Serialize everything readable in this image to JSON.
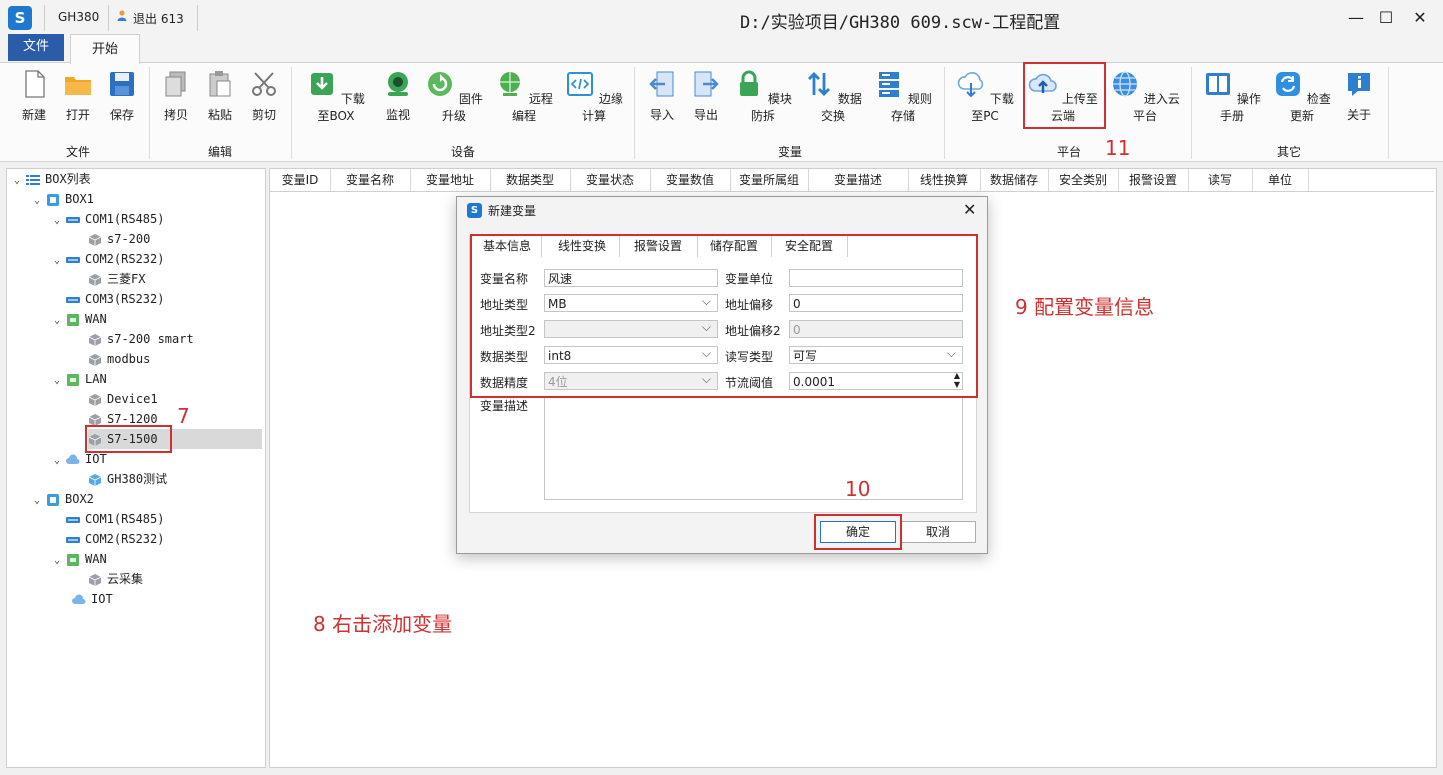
{
  "titlebar": {
    "app_logo": "S",
    "device_name": "GH380",
    "logout_label": "退出 613",
    "window_title": "D:/实验项目/GH380 609.scw-工程配置",
    "minimize": "—",
    "maximize": "☐",
    "close": "✕"
  },
  "ribbon_tabs": {
    "file": "文件",
    "start": "开始"
  },
  "ribbon": {
    "buttons": {
      "new": "新建",
      "open": "打开",
      "save": "保存",
      "copy": "拷贝",
      "paste": "粘贴",
      "cut": "剪切",
      "download_box": "下载至BOX",
      "monitor": "监视",
      "firmware": "固件升级",
      "remote_program": "远程编程",
      "edge_compute": "边缘计算",
      "import": "导入",
      "export": "导出",
      "module_protect": "模块防拆",
      "data_exchange": "数据交换",
      "rule_storage": "规则存储",
      "download_pc": "下载至PC",
      "upload_cloud": "上传至云端",
      "enter_cloud": "进入云平台",
      "manual": "操作手册",
      "check_update": "检查更新",
      "about": "关于"
    },
    "groups": {
      "file": "文件",
      "edit": "编辑",
      "device": "设备",
      "variable": "变量",
      "platform": "平台",
      "other": "其它"
    }
  },
  "tree": {
    "root": "BOX列表",
    "nodes": {
      "box1": "BOX1",
      "com1": "COM1(RS485)",
      "s7200": "s7-200",
      "com2": "COM2(RS232)",
      "mitsubishi": "三菱FX",
      "com3": "COM3(RS232)",
      "wan": "WAN",
      "s7200smart": "s7-200 smart",
      "modbus": "modbus",
      "lan": "LAN",
      "device1": "Device1",
      "s71200": "S7-1200",
      "s71500": "S7-1500",
      "iot": "IOT",
      "gh380test": "GH380测试",
      "box2": "BOX2",
      "b2com1": "COM1(RS485)",
      "b2com2": "COM2(RS232)",
      "b2wan": "WAN",
      "cloud_collect": "云采集",
      "b2iot": "IOT"
    }
  },
  "table_headers": [
    "变量ID",
    "变量名称",
    "变量地址",
    "数据类型",
    "变量状态",
    "变量数值",
    "变量所属组",
    "变量描述",
    "线性换算",
    "数据储存",
    "安全类别",
    "报警设置",
    "读写",
    "单位"
  ],
  "dialog": {
    "title": "新建变量",
    "close": "✕",
    "tabs": [
      "基本信息",
      "线性变换",
      "报警设置",
      "储存配置",
      "安全配置"
    ],
    "fields": {
      "var_name_label": "变量名称",
      "var_name_value": "风速",
      "var_unit_label": "变量单位",
      "var_unit_value": "",
      "addr_type_label": "地址类型",
      "addr_type_value": "MB",
      "addr_offset_label": "地址偏移",
      "addr_offset_value": "0",
      "addr_type2_label": "地址类型2",
      "addr_type2_value": "",
      "addr_offset2_label": "地址偏移2",
      "addr_offset2_value": "0",
      "data_type_label": "数据类型",
      "data_type_value": "int8",
      "rw_type_label": "读写类型",
      "rw_type_value": "可写",
      "precision_label": "数据精度",
      "precision_value": "4位",
      "throttle_label": "节流阈值",
      "throttle_value": "0.0001",
      "desc_label": "变量描述"
    },
    "ok": "确定",
    "cancel": "取消"
  },
  "annotations": {
    "a7": "7",
    "a8": "8 右击添加变量",
    "a9": "9 配置变量信息",
    "a10": "10",
    "a11": "11"
  },
  "colors": {
    "accent": "#2a5caa",
    "annotation": "#d03030",
    "brand": "#1e78d0"
  }
}
